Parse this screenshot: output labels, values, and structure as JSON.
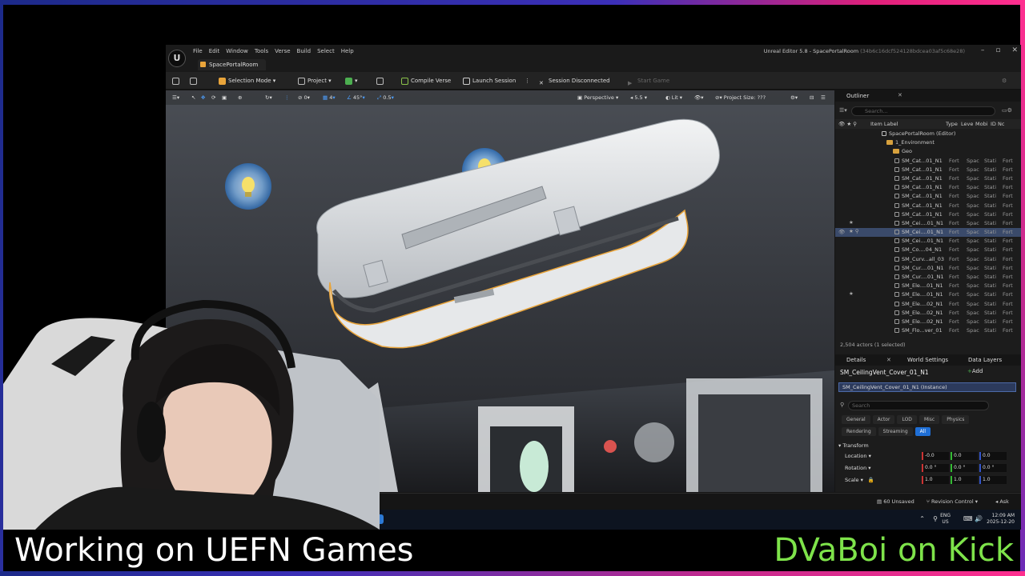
{
  "editor": {
    "menu": [
      "File",
      "Edit",
      "Window",
      "Tools",
      "Verse",
      "Build",
      "Select",
      "Help"
    ],
    "window_title": "Unreal Editor 5.8 - SpacePortalRoom",
    "window_hash": "(34b6c16dcf524128bdcea03af5c68e28)",
    "doc_tab": "SpacePortalRoom"
  },
  "toolbar": {
    "selection_mode": "Selection Mode",
    "project": "Project",
    "compile_verse": "Compile Verse",
    "launch_session": "Launch Session",
    "session_status": "Session Disconnected",
    "start_game": "Start Game"
  },
  "viewport": {
    "snap_translate": "0",
    "grid_size": "4",
    "rotation_snap": "45°",
    "scale_snap": "0.5",
    "view_mode": "Perspective",
    "camera_speed": "5.5",
    "lighting": "Lit",
    "project_size": "Project Size: ???"
  },
  "outliner": {
    "title": "Outliner",
    "search_placeholder": "Search...",
    "columns": {
      "label": "Item Label",
      "type": "Type",
      "level": "Leve",
      "mobility": "Mobi",
      "id": "ID Nc"
    },
    "root": "SpacePortalRoom (Editor)",
    "folder_env": "1_Environment",
    "folder_geo": "Geo",
    "rows": [
      {
        "name": "SM_Cat...01_N1",
        "c1": "Fort",
        "c2": "Spac",
        "c3": "Stati",
        "c4": "Fort"
      },
      {
        "name": "SM_Cat...01_N1",
        "c1": "Fort",
        "c2": "Spac",
        "c3": "Stati",
        "c4": "Fort"
      },
      {
        "name": "SM_Cat...01_N1",
        "c1": "Fort",
        "c2": "Spac",
        "c3": "Stati",
        "c4": "Fort"
      },
      {
        "name": "SM_Cat...01_N1",
        "c1": "Fort",
        "c2": "Spac",
        "c3": "Stati",
        "c4": "Fort"
      },
      {
        "name": "SM_Cat...01_N1",
        "c1": "Fort",
        "c2": "Spac",
        "c3": "Stati",
        "c4": "Fort"
      },
      {
        "name": "SM_Cat...01_N1",
        "c1": "Fort",
        "c2": "Spac",
        "c3": "Stati",
        "c4": "Fort"
      },
      {
        "name": "SM_Cat...01_N1",
        "c1": "Fort",
        "c2": "Spac",
        "c3": "Stati",
        "c4": "Fort"
      },
      {
        "name": "SM_Cei....01_N1",
        "c1": "Fort",
        "c2": "Spac",
        "c3": "Stati",
        "c4": "Fort"
      },
      {
        "name": "SM_Cei....01_N1",
        "c1": "Fort",
        "c2": "Spac",
        "c3": "Stati",
        "c4": "Fort"
      },
      {
        "name": "SM_Cei....01_N1",
        "c1": "Fort",
        "c2": "Spac",
        "c3": "Stati",
        "c4": "Fort"
      },
      {
        "name": "SM_Co....04_N1",
        "c1": "Fort",
        "c2": "Spac",
        "c3": "Stati",
        "c4": "Fort"
      },
      {
        "name": "SM_Curv...all_03",
        "c1": "Fort",
        "c2": "Spac",
        "c3": "Stati",
        "c4": "Fort"
      },
      {
        "name": "SM_Cur....01_N1",
        "c1": "Fort",
        "c2": "Spac",
        "c3": "Stati",
        "c4": "Fort"
      },
      {
        "name": "SM_Cur....01_N1",
        "c1": "Fort",
        "c2": "Spac",
        "c3": "Stati",
        "c4": "Fort"
      },
      {
        "name": "SM_Ele....01_N1",
        "c1": "Fort",
        "c2": "Spac",
        "c3": "Stati",
        "c4": "Fort"
      },
      {
        "name": "SM_Ele....01_N1",
        "c1": "Fort",
        "c2": "Spac",
        "c3": "Stati",
        "c4": "Fort"
      },
      {
        "name": "SM_Ele....02_N1",
        "c1": "Fort",
        "c2": "Spac",
        "c3": "Stati",
        "c4": "Fort"
      },
      {
        "name": "SM_Ele....02_N1",
        "c1": "Fort",
        "c2": "Spac",
        "c3": "Stati",
        "c4": "Fort"
      },
      {
        "name": "SM_Ele....02_N1",
        "c1": "Fort",
        "c2": "Spac",
        "c3": "Stati",
        "c4": "Fort"
      },
      {
        "name": "SM_Flo...ver_01",
        "c1": "Fort",
        "c2": "Spac",
        "c3": "Stati",
        "c4": "Fort"
      }
    ],
    "footer": "2,504 actors (1 selected)"
  },
  "details": {
    "tab_details": "Details",
    "tab_world": "World Settings",
    "tab_layers": "Data Layers",
    "actor_name": "SM_CeilingVent_Cover_01_N1",
    "add": "Add",
    "instance": "SM_CeilingVent_Cover_01_N1 (Instance)",
    "search_placeholder": "Search",
    "filters": [
      "General",
      "Actor",
      "LOD",
      "Misc",
      "Physics"
    ],
    "filters2": [
      "Rendering",
      "Streaming",
      "All"
    ],
    "transform": "Transform",
    "location_label": "Location",
    "rotation_label": "Rotation",
    "scale_label": "Scale",
    "location": [
      "-0.0",
      "0.0",
      "0.0"
    ],
    "rotation": [
      "0.0 °",
      "0.0 °",
      "0.0 °"
    ],
    "scale": [
      "1.0",
      "1.0",
      "1.0"
    ]
  },
  "status": {
    "unsaved": "60 Unsaved",
    "revision": "Revision Control",
    "ask": "Ask"
  },
  "taskbar": {
    "lang_top": "ENG",
    "lang_bottom": "US",
    "time": "12:09 AM",
    "date": "2025-12-20"
  },
  "overlay": {
    "left": "Working on UEFN Games",
    "right": "DVaBoi on Kick"
  },
  "colors": {
    "accent_blue": "#1f6fd6",
    "kick_green": "#7ee34a",
    "selection_outline": "#e9a43a"
  }
}
